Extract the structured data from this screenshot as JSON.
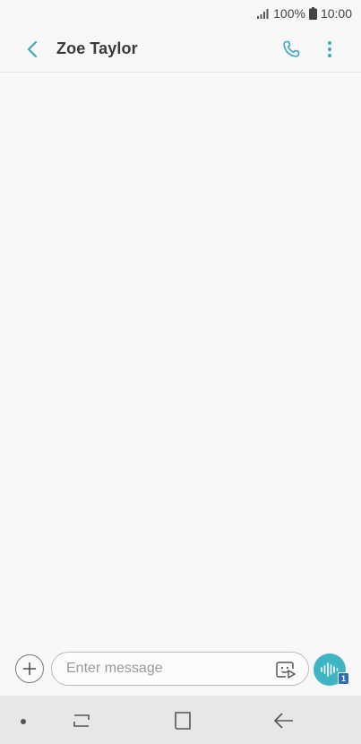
{
  "status_bar": {
    "battery": "100%",
    "time": "10:00"
  },
  "header": {
    "contact_name": "Zoe Taylor",
    "icons": [
      "back-arrow-icon",
      "phone-call-icon",
      "more-options-icon"
    ]
  },
  "composer": {
    "placeholder": "Enter message",
    "value": "",
    "icons": [
      "add-icon",
      "sticker-icon",
      "voice-recorder-icon"
    ],
    "sim_badge": "1"
  },
  "nav_bar": {
    "icons": [
      "dot-icon",
      "recents-icon",
      "home-icon",
      "back-icon"
    ]
  },
  "colors": {
    "accent": "#3fb5c4",
    "badge": "#2e6fb4",
    "background": "#f8f8f8",
    "nav_background": "#e7e7e7"
  }
}
